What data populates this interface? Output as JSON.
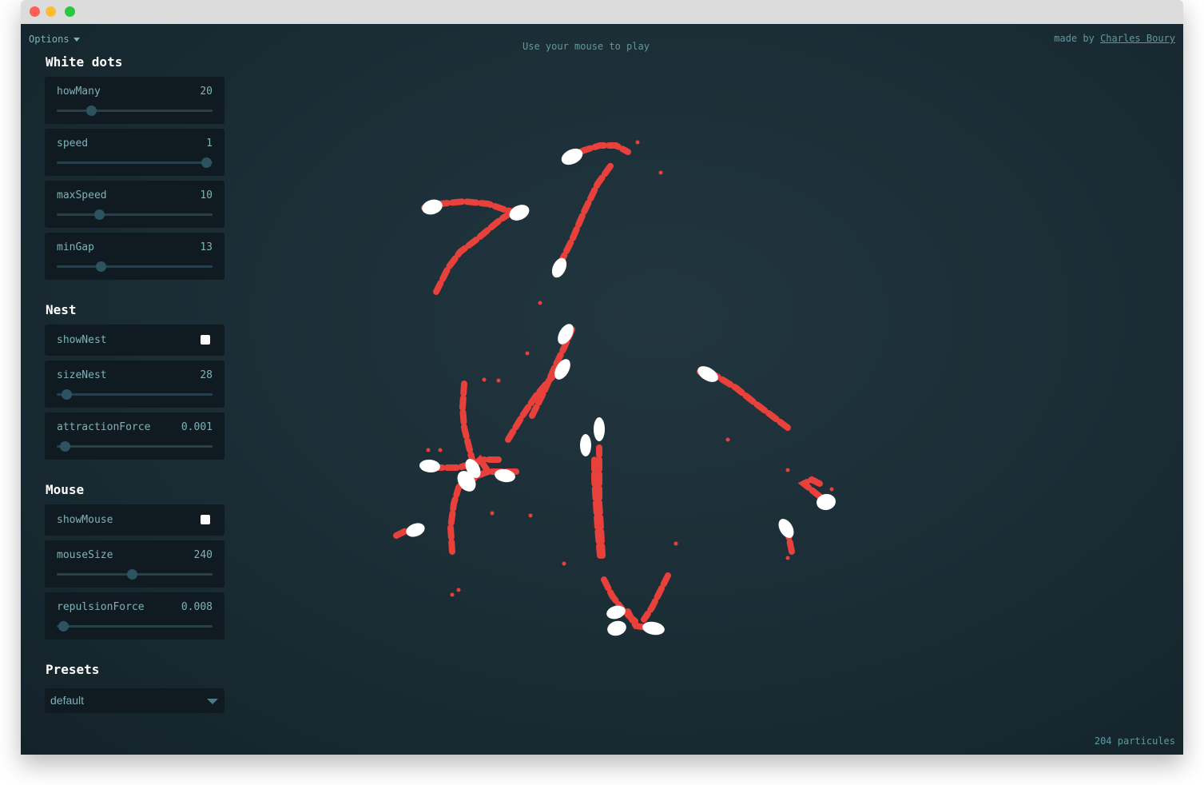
{
  "header": {
    "options_label": "Options",
    "hint": "Use your mouse to play",
    "credit_prefix": "made by",
    "credit_author": "Charles Boury"
  },
  "footer": {
    "count_text": "204 particules"
  },
  "sections": {
    "white_dots": {
      "title": "White dots",
      "howMany": {
        "label": "howMany",
        "value": "20",
        "fraction": 0.22
      },
      "speed": {
        "label": "speed",
        "value": "1",
        "fraction": 0.96
      },
      "maxSpeed": {
        "label": "maxSpeed",
        "value": "10",
        "fraction": 0.27
      },
      "minGap": {
        "label": "minGap",
        "value": "13",
        "fraction": 0.28
      }
    },
    "nest": {
      "title": "Nest",
      "showNest": {
        "label": "showNest",
        "checked": true
      },
      "sizeNest": {
        "label": "sizeNest",
        "value": "28",
        "fraction": 0.06
      },
      "attractionForce": {
        "label": "attractionForce",
        "value": "0.001",
        "fraction": 0.05
      }
    },
    "mouse": {
      "title": "Mouse",
      "showMouse": {
        "label": "showMouse",
        "checked": true
      },
      "mouseSize": {
        "label": "mouseSize",
        "value": "240",
        "fraction": 0.48
      },
      "repulsionForce": {
        "label": "repulsionForce",
        "value": "0.008",
        "fraction": 0.04
      }
    },
    "presets": {
      "title": "Presets",
      "selected": "default"
    }
  },
  "colors": {
    "background": "#1b2e36",
    "trail": "#e8413c",
    "dot": "#ffffff",
    "label": "#7fb3b8"
  }
}
